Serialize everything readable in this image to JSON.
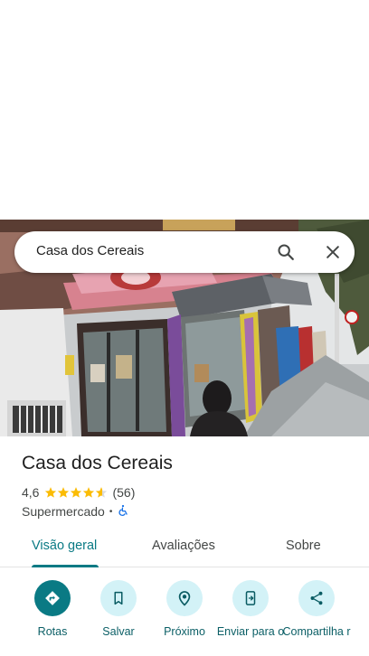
{
  "search": {
    "query": "Casa dos Cereais"
  },
  "place": {
    "name": "Casa dos Cereais",
    "rating": "4,6",
    "stars": 4.6,
    "reviews": "(56)",
    "category": "Supermercado",
    "separator": "•",
    "accessibility_icon": "wheelchair-icon"
  },
  "tabs": [
    {
      "label": "Visão geral",
      "active": true
    },
    {
      "label": "Avaliações",
      "active": false
    },
    {
      "label": "Sobre",
      "active": false
    }
  ],
  "actions": [
    {
      "label": "Rotas",
      "icon": "directions-icon"
    },
    {
      "label": "Salvar",
      "icon": "bookmark-icon"
    },
    {
      "label": "Próximo",
      "icon": "nearby-icon"
    },
    {
      "label": "Enviar para o",
      "icon": "send-to-phone-icon"
    },
    {
      "label": "Compartilha r",
      "icon": "share-icon"
    }
  ],
  "colors": {
    "accent": "#0a7a84",
    "action_bg": "#d3f2f7",
    "star": "#fbbc04"
  }
}
